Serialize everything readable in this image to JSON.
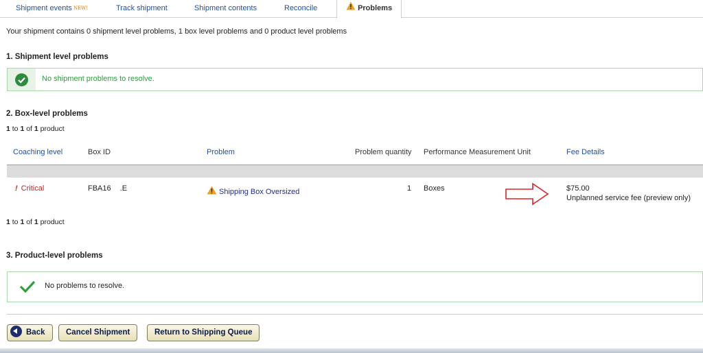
{
  "tabs": [
    {
      "label": "Shipment events",
      "badge": "NEW!"
    },
    {
      "label": "Track shipment"
    },
    {
      "label": "Shipment contents"
    },
    {
      "label": "Reconcile"
    },
    {
      "label": "Problems",
      "icon": "warning-icon",
      "active": true
    }
  ],
  "summary": "Your shipment contains 0 shipment level problems, 1 box level problems and 0 product level problems",
  "shipment_level": {
    "heading": "1. Shipment level problems",
    "message": "No shipment problems to resolve.",
    "icon": "check-circle-icon"
  },
  "box_level": {
    "heading": "2. Box-level problems",
    "pager": {
      "from": "1",
      "to_word": "to",
      "to": "1",
      "of_word": "of",
      "total": "1",
      "unit": "product"
    },
    "columns": {
      "coaching_level": "Coaching level",
      "box_id": "Box ID",
      "problem": "Problem",
      "problem_quantity": "Problem quantity",
      "unit": "Performance Measurement Unit",
      "fee_details": "Fee Details"
    },
    "row": {
      "coaching_mark": "!",
      "coaching_level": "Critical",
      "box_id": "FBA16",
      "box_id_suffix": ".E",
      "problem": "Shipping Box Oversized",
      "quantity": "1",
      "unit": "Boxes",
      "fee_amount": "$75.00",
      "fee_note": "Unplanned service fee (preview only)"
    }
  },
  "product_level": {
    "heading": "3. Product-level problems",
    "message": "No problems to resolve.",
    "icon": "checkmark-icon"
  },
  "buttons": {
    "back": "Back",
    "cancel": "Cancel Shipment",
    "return": "Return to Shipping Queue"
  },
  "colors": {
    "link": "#1f4fa8",
    "success": "#2e9e3e",
    "critical": "#cc1f1f",
    "annotation_arrow": "#e02020",
    "warning": "#f0a020"
  }
}
